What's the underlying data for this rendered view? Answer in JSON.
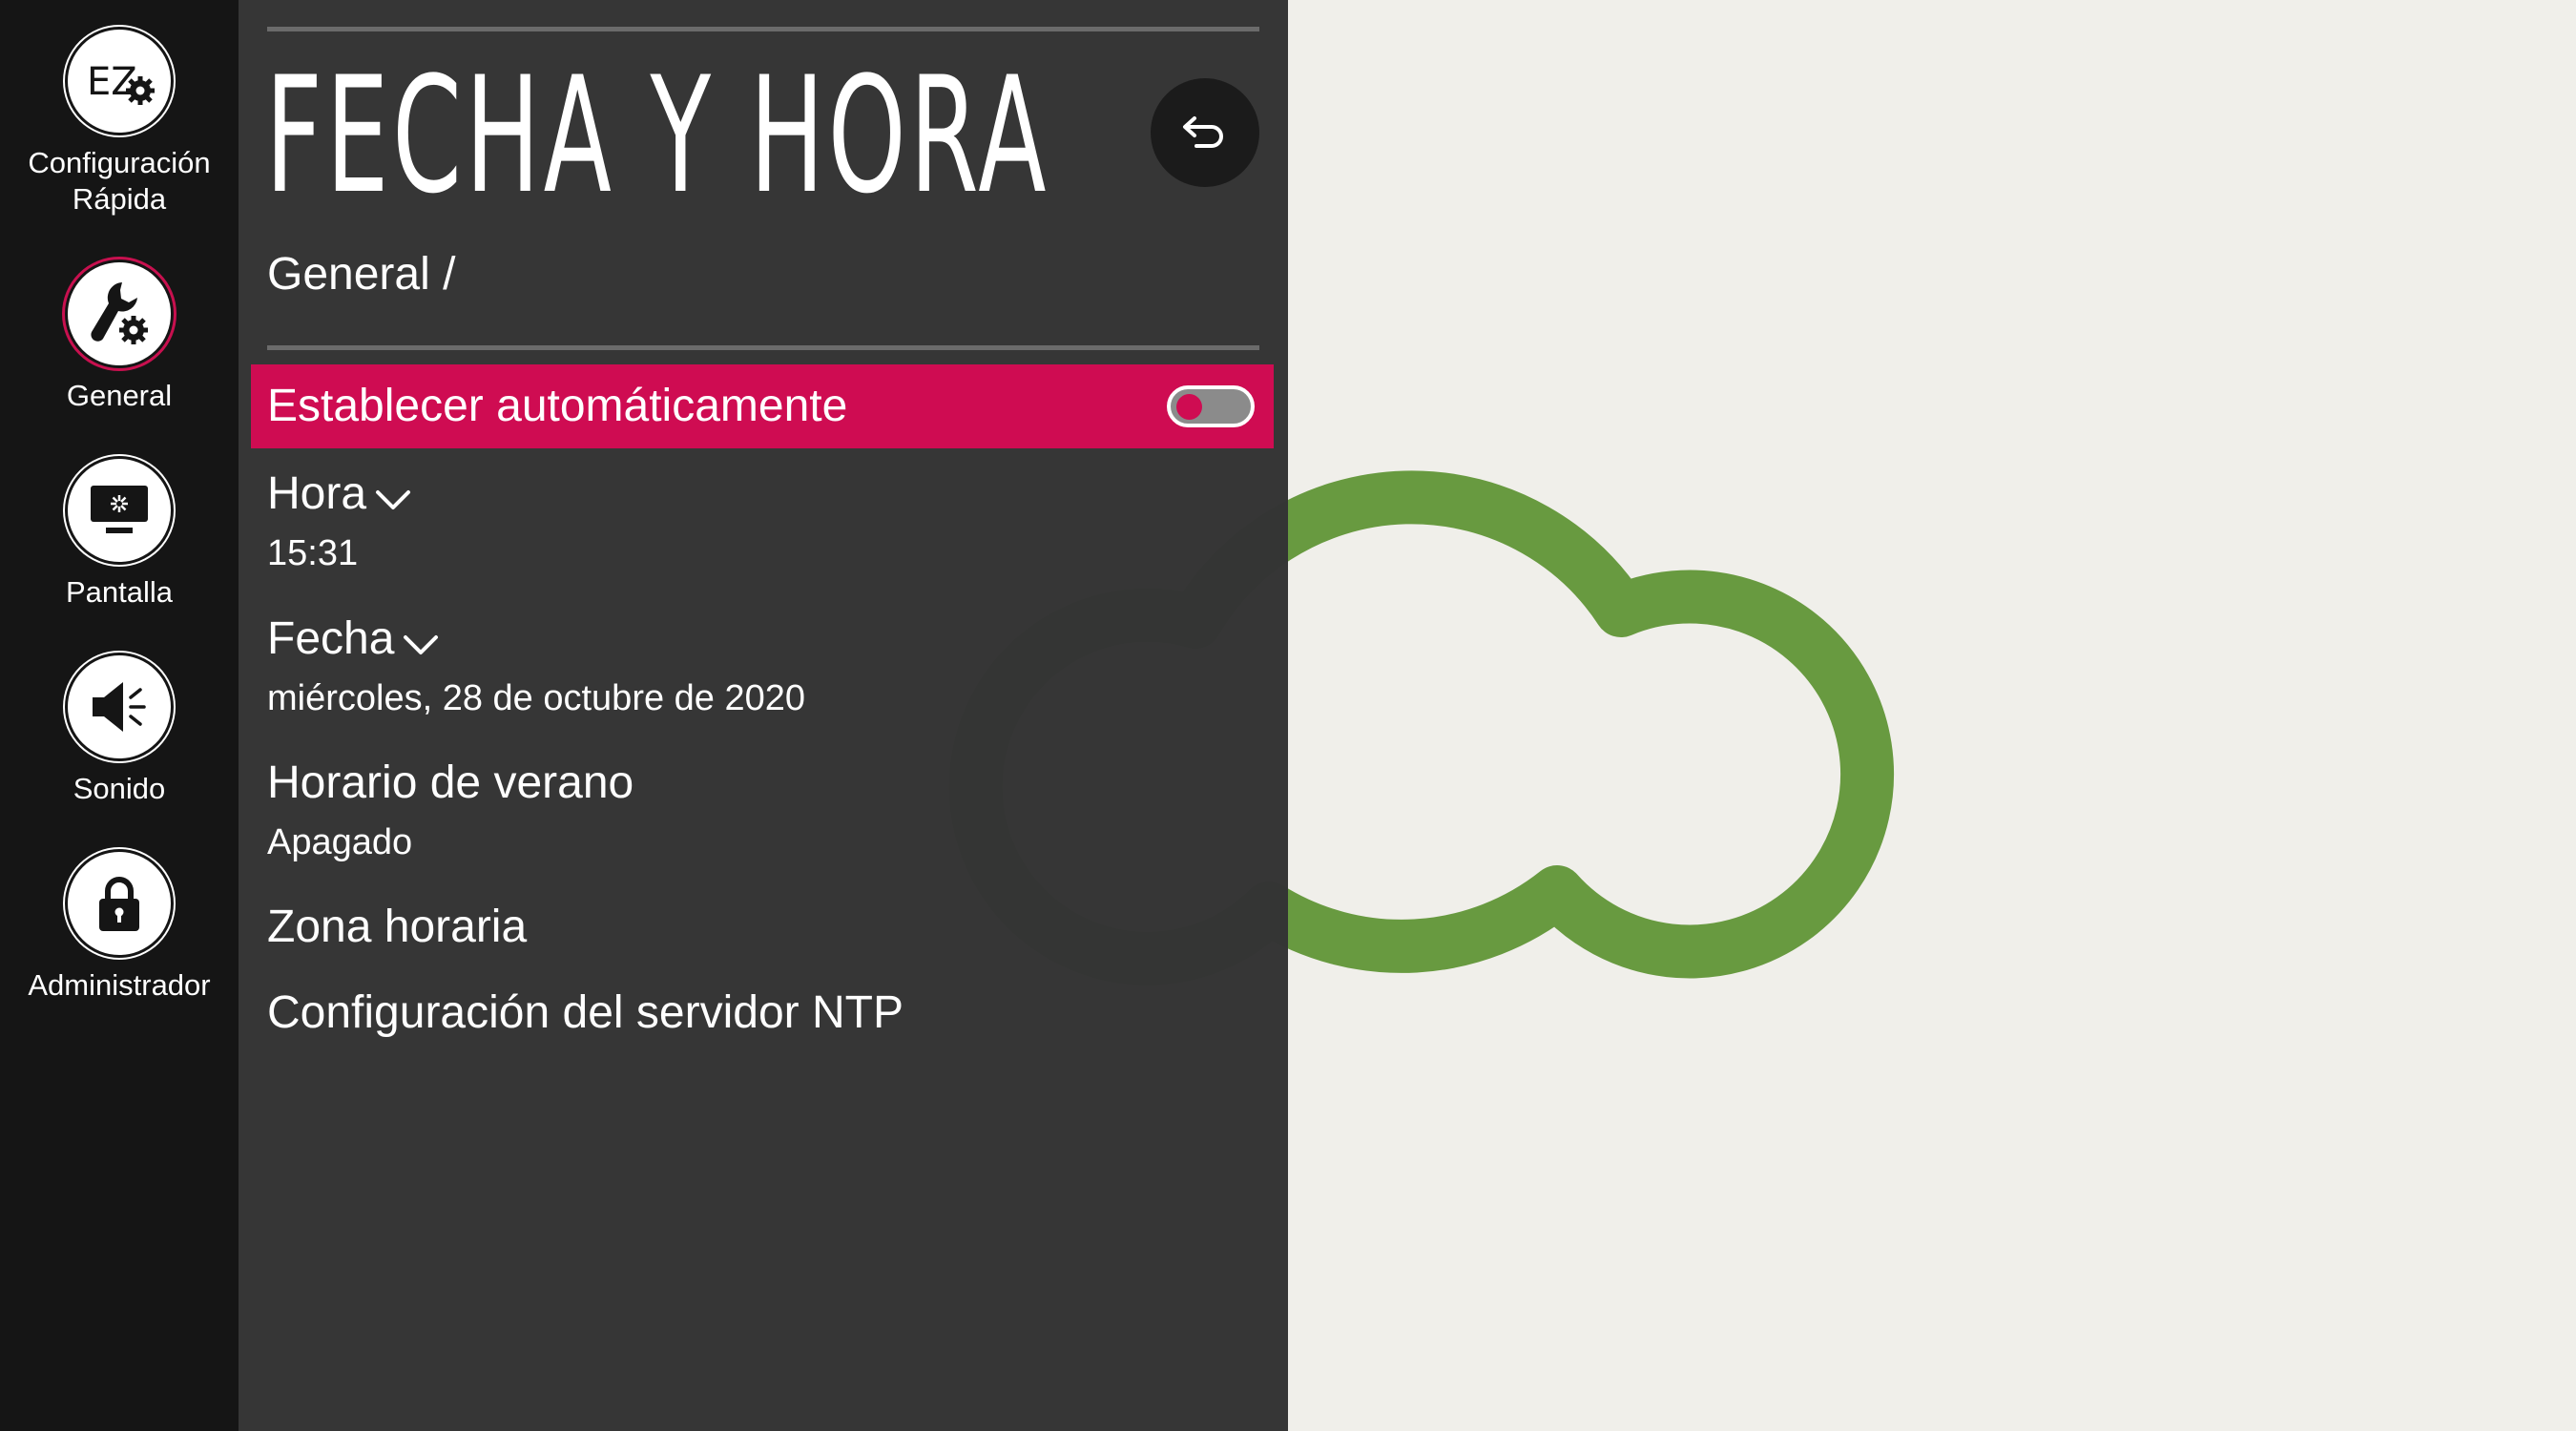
{
  "nav": {
    "items": [
      {
        "icon": "ez-setup-icon",
        "label_line1": "Configuración",
        "label_line2": "Rápida"
      },
      {
        "icon": "wrench-gear-icon",
        "label": "General",
        "active": true
      },
      {
        "icon": "monitor-icon",
        "label": "Pantalla"
      },
      {
        "icon": "speaker-icon",
        "label": "Sonido"
      },
      {
        "icon": "lock-icon",
        "label": "Administrador"
      }
    ],
    "ez_text": "EZ"
  },
  "panel": {
    "title": "FECHA Y HORA",
    "breadcrumb": "General /",
    "back_icon": "back-arrow-icon",
    "auto_set": {
      "label": "Establecer automáticamente",
      "enabled": false
    },
    "items": [
      {
        "label": "Hora",
        "value": "15:31",
        "expandable": true
      },
      {
        "label": "Fecha",
        "value": "miércoles, 28 de octubre de 2020",
        "expandable": true
      },
      {
        "label": "Horario de verano",
        "value": "Apagado"
      },
      {
        "label": "Zona horaria"
      },
      {
        "label": "Configuración del servidor NTP"
      }
    ]
  },
  "colors": {
    "accent": "#cf0c52",
    "rail": "#151515",
    "panel": "#343434",
    "background": "#f0efea",
    "cloud": "#689a40"
  }
}
